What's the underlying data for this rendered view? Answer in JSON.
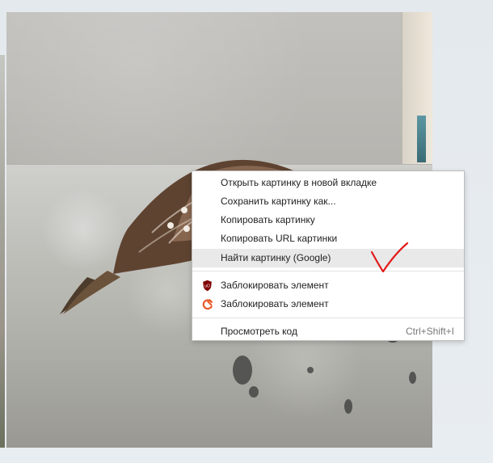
{
  "context_menu": {
    "items": [
      {
        "label": "Открыть картинку в новой вкладке"
      },
      {
        "label": "Сохранить картинку как..."
      },
      {
        "label": "Копировать картинку"
      },
      {
        "label": "Копировать URL картинки"
      },
      {
        "label": "Найти картинку (Google)"
      },
      {
        "label": "Заблокировать элемент",
        "icon": "ublock-icon"
      },
      {
        "label": "Заблокировать элемент",
        "icon": "adblock-icon"
      },
      {
        "label": "Просмотреть код",
        "shortcut": "Ctrl+Shift+I"
      }
    ]
  },
  "photo": {
    "subject_icon": "bird-icon"
  },
  "annotation": {
    "icon": "checkmark-icon",
    "color": "#e31919"
  }
}
